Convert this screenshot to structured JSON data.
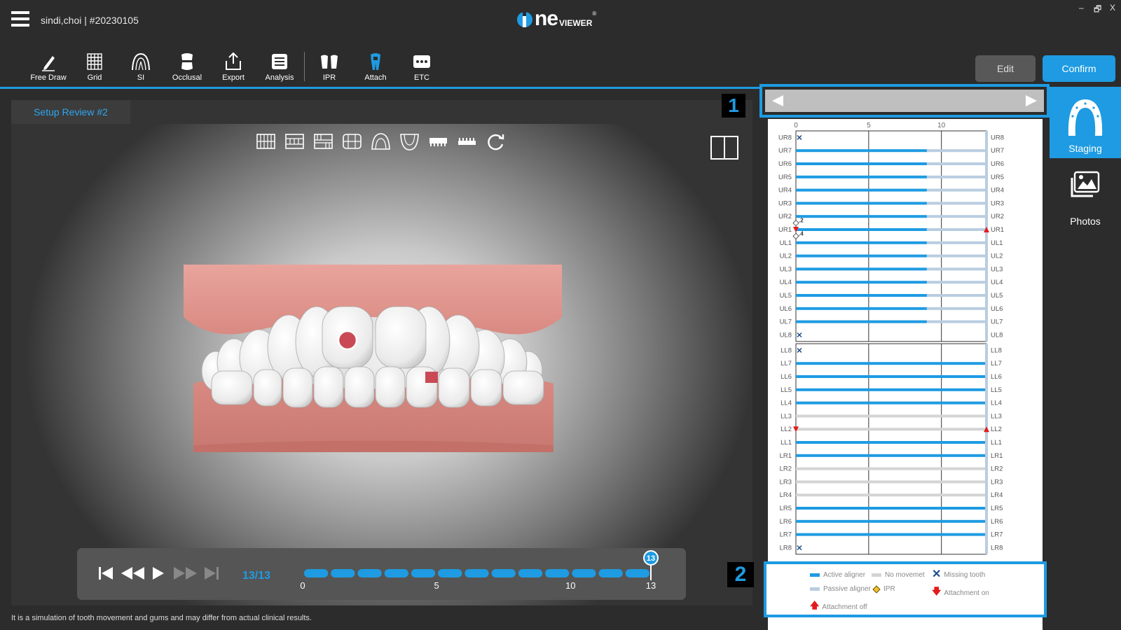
{
  "header": {
    "case_title": "sindi,choi | #20230105",
    "logo_text": "ne",
    "logo_viewer": "VIEWER",
    "logo_reg": "®",
    "window_controls": [
      "–",
      "🗗",
      "X"
    ]
  },
  "toolbar": {
    "items": [
      {
        "label": "Free Draw",
        "icon": "pencil-icon"
      },
      {
        "label": "Grid",
        "icon": "grid-icon"
      },
      {
        "label": "SI",
        "icon": "si-arch-icon"
      },
      {
        "label": "Occlusal",
        "icon": "occlusal-icon"
      },
      {
        "label": "Export",
        "icon": "export-icon"
      },
      {
        "label": "Analysis",
        "icon": "analysis-icon"
      },
      {
        "label": "IPR",
        "icon": "ipr-icon"
      },
      {
        "label": "Attach",
        "icon": "attach-icon"
      },
      {
        "label": "ETC",
        "icon": "ellipsis-icon"
      }
    ],
    "edit_label": "Edit",
    "confirm_label": "Confirm",
    "accent": "#1e9be2"
  },
  "viewer": {
    "tab_label": "Setup Review #2",
    "view_buttons": [
      "front-view-icon",
      "top-view-icon",
      "bottom-view-icon",
      "left-view-icon",
      "upper-arch-icon",
      "lower-arch-icon",
      "upper-jaw-icon",
      "lower-jaw-icon",
      "reset-rotation-icon"
    ],
    "gum_color": "#e29a95",
    "tooth_color": "#ffffff"
  },
  "playback": {
    "frame_text": "13/13",
    "current_step": 13,
    "total_steps": 13,
    "tick_labels": [
      "0",
      "5",
      "10",
      "13"
    ],
    "tick_values": [
      0,
      5,
      10,
      13
    ],
    "current_label": "13"
  },
  "disclaimer": "It is a simulation of tooth movement and gums and may differ from actual clinical results.",
  "markers": {
    "one": "1",
    "two": "2"
  },
  "chart_data": {
    "type": "table",
    "x_ticks": [
      "0",
      "5",
      "10"
    ],
    "x_tick_values": [
      0,
      5,
      10
    ],
    "total_steps": 13,
    "upper": [
      {
        "tooth": "UR8",
        "status": "missing",
        "active_end": 0
      },
      {
        "tooth": "UR7",
        "status": "active",
        "active_end": 9
      },
      {
        "tooth": "UR6",
        "status": "active",
        "active_end": 9
      },
      {
        "tooth": "UR5",
        "status": "active",
        "active_end": 9
      },
      {
        "tooth": "UR4",
        "status": "active",
        "active_end": 9
      },
      {
        "tooth": "UR3",
        "status": "active",
        "active_end": 9
      },
      {
        "tooth": "UR2",
        "status": "active",
        "active_end": 9,
        "ipr": ".2"
      },
      {
        "tooth": "UR1",
        "status": "active",
        "active_end": 9,
        "attachment": true,
        "ipr": ".4"
      },
      {
        "tooth": "UL1",
        "status": "active",
        "active_end": 9
      },
      {
        "tooth": "UL2",
        "status": "active",
        "active_end": 9
      },
      {
        "tooth": "UL3",
        "status": "active",
        "active_end": 9
      },
      {
        "tooth": "UL4",
        "status": "active",
        "active_end": 9
      },
      {
        "tooth": "UL5",
        "status": "active",
        "active_end": 9
      },
      {
        "tooth": "UL6",
        "status": "active",
        "active_end": 9
      },
      {
        "tooth": "UL7",
        "status": "active",
        "active_end": 9
      },
      {
        "tooth": "UL8",
        "status": "missing",
        "active_end": 0
      }
    ],
    "lower": [
      {
        "tooth": "LL8",
        "status": "missing",
        "active_end": 0
      },
      {
        "tooth": "LL7",
        "status": "active",
        "active_end": 13
      },
      {
        "tooth": "LL6",
        "status": "active",
        "active_end": 13
      },
      {
        "tooth": "LL5",
        "status": "active",
        "active_end": 13
      },
      {
        "tooth": "LL4",
        "status": "active",
        "active_end": 13
      },
      {
        "tooth": "LL3",
        "status": "none",
        "active_end": 0
      },
      {
        "tooth": "LL2",
        "status": "none",
        "active_end": 0,
        "attachment": true
      },
      {
        "tooth": "LL1",
        "status": "active",
        "active_end": 13
      },
      {
        "tooth": "LR1",
        "status": "active",
        "active_end": 13
      },
      {
        "tooth": "LR2",
        "status": "none",
        "active_end": 0
      },
      {
        "tooth": "LR3",
        "status": "none",
        "active_end": 0
      },
      {
        "tooth": "LR4",
        "status": "none",
        "active_end": 0
      },
      {
        "tooth": "LR5",
        "status": "active",
        "active_end": 13
      },
      {
        "tooth": "LR6",
        "status": "active",
        "active_end": 13
      },
      {
        "tooth": "LR7",
        "status": "active",
        "active_end": 13
      },
      {
        "tooth": "LR8",
        "status": "missing",
        "active_end": 0
      }
    ],
    "colors": {
      "active": "#1e9be2",
      "passive": "#b9cde0",
      "none": "#d4d4d4",
      "missing": "#1d4f8a",
      "attachment": "#e21b1b",
      "ipr": "#f2c12e"
    }
  },
  "legend": {
    "items": [
      {
        "label": "Active aligner",
        "color": "#1e9be2"
      },
      {
        "label": "No movemet",
        "color": "#d4d4d4"
      },
      {
        "label": "Missing tooth",
        "color": "#1d4f8a"
      },
      {
        "label": "Passive aligner",
        "color": "#b9cde0"
      },
      {
        "label": "IPR",
        "color": "#f2c12e"
      },
      {
        "label": "Attachment on",
        "color": "#e21b1b"
      },
      {
        "label": "Attachment off",
        "color": "#e21b1b"
      }
    ]
  },
  "sidebar": {
    "staging_label": "Staging",
    "photos_label": "Photos"
  }
}
